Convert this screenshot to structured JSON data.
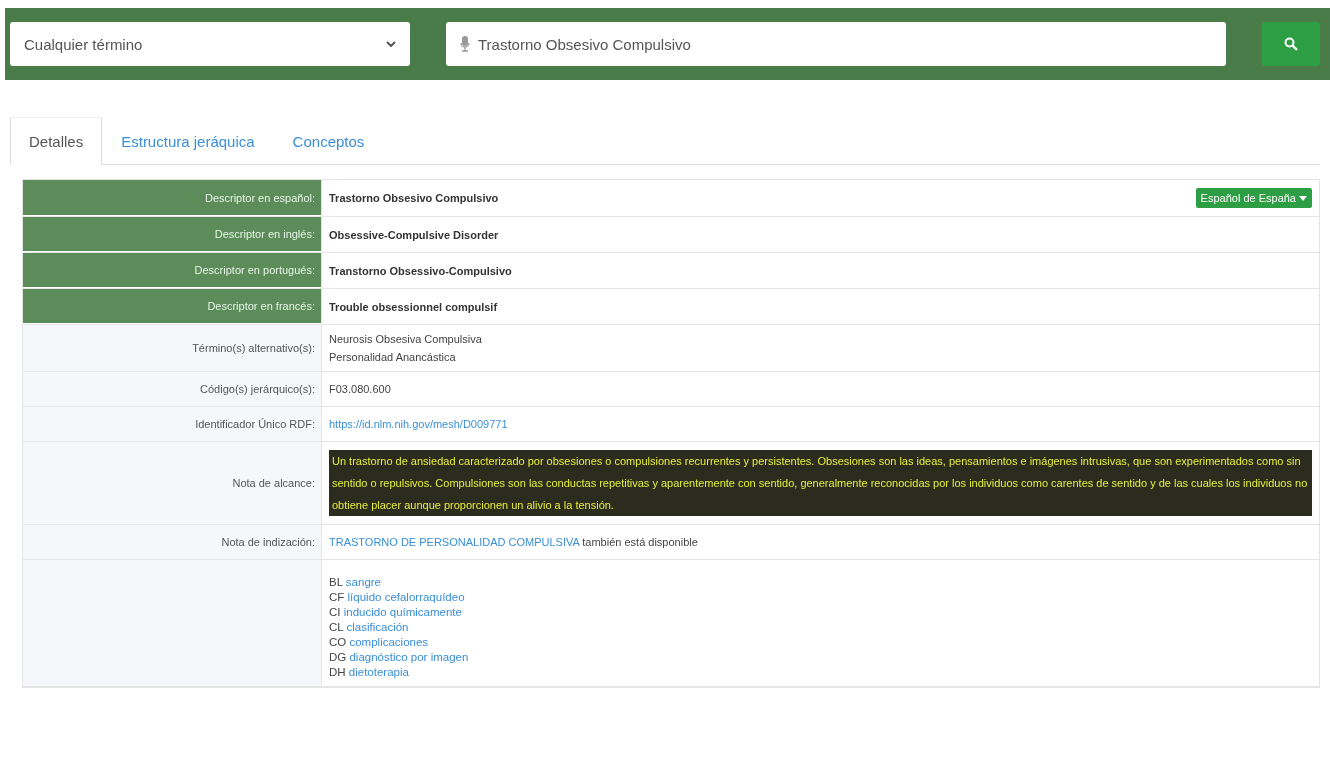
{
  "search_bar": {
    "scope_select": "Cualquier término",
    "query": "Trastorno Obsesivo Compulsivo"
  },
  "tabs": [
    {
      "label": "Detalles",
      "selected": true
    },
    {
      "label": "Estructura jeráquica",
      "selected": false
    },
    {
      "label": "Conceptos",
      "selected": false
    }
  ],
  "language_button": "Español de España",
  "rows": [
    {
      "kind": "descriptor",
      "label": "Descriptor en español:",
      "value": "Trastorno Obsesivo Compulsivo"
    },
    {
      "kind": "descriptor",
      "label": "Descriptor en inglés:",
      "value": "Obsessive-Compulsive Disorder"
    },
    {
      "kind": "descriptor",
      "label": "Descriptor en portugués:",
      "value": "Transtorno Obsessivo-Compulsivo"
    },
    {
      "kind": "descriptor",
      "label": "Descriptor en francés:",
      "value": "Trouble obsessionnel compulsif"
    },
    {
      "kind": "lines",
      "label": "Término(s) alternativo(s):",
      "lines": [
        "Neurosis Obsesiva Compulsiva",
        "Personalidad Anancástica"
      ]
    },
    {
      "kind": "text",
      "label": "Código(s) jerárquico(s):",
      "value": "F03.080.600"
    },
    {
      "kind": "link",
      "label": "Identificador Único RDF:",
      "value": "https://id.nlm.nih.gov/mesh/D009771"
    },
    {
      "kind": "note",
      "label": "Nota de alcance:",
      "highlighted": true,
      "value": "Un trastorno de ansiedad caracterizado por obsesiones o compulsiones recurrentes y persistentes. Obsesiones son las ideas, pensamientos e imágenes intrusivas, que son experimentados como sin sentido o repulsivos. Compulsiones son las conductas repetitivas y aparentemente con sentido, generalmente reconocidas por los individuos como carentes de sentido y de las cuales los individuos no obtiene placer aunque proporcionen un alivio a la tensión."
    },
    {
      "kind": "indexing",
      "label": "Nota de indización:",
      "link": "TRASTORNO DE PERSONALIDAD COMPULSIVA",
      "value": "también está disponible"
    },
    {
      "kind": "qualifiers",
      "items": [
        {
          "code": "BL",
          "name": "sangre"
        },
        {
          "code": "CF",
          "name": "líquido cefalorraquídeo"
        },
        {
          "code": "CI",
          "name": "inducido químicamente"
        },
        {
          "code": "CL",
          "name": "clasificación"
        },
        {
          "code": "CO",
          "name": "complicaciones"
        },
        {
          "code": "DG",
          "name": "diagnóstico por imagen"
        },
        {
          "code": "DH",
          "name": "dietoterapia"
        }
      ]
    }
  ]
}
